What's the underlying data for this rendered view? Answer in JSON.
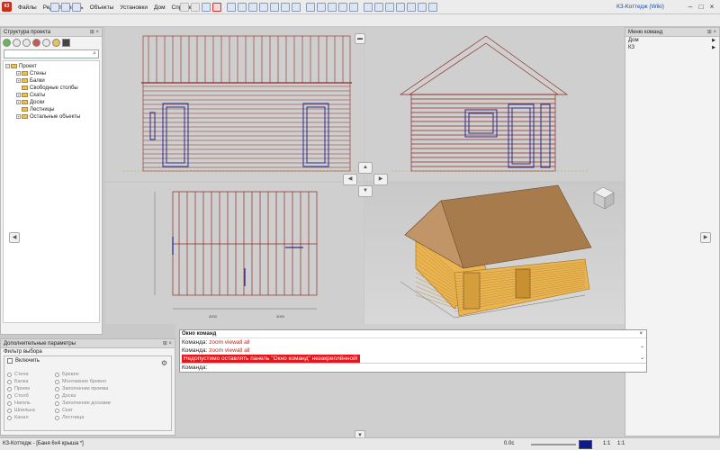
{
  "app": {
    "title": "КЗ-Коттедж (Wiki)",
    "icon_label": "К3"
  },
  "menu": [
    "Файлы",
    "Редактировать",
    "Объекты",
    "Установки",
    "Дом",
    "Справка"
  ],
  "project_panel": {
    "title": "Структура проекта",
    "tree_root": "Проект",
    "tree_items": [
      "Стены",
      "Балки",
      "Свободные столбы",
      "Скаты",
      "Доски",
      "Лестницы",
      "Остальные объекты"
    ]
  },
  "command_menu": {
    "title": "Меню команд",
    "items": [
      "Дом",
      "КЗ"
    ]
  },
  "params_panel": {
    "title": "Дополнительные параметры",
    "filter_title": "Фильтр выбора",
    "enable_label": "Включить",
    "col1": [
      "Стена",
      "Балка",
      "Проем",
      "Столб",
      "Нагель",
      "Шпилька",
      "Канал"
    ],
    "col2": [
      "Бревно",
      "Монтажное бревно",
      "Заполнение проема",
      "Доска",
      "Заполнение досками",
      "Скат",
      "Лестница"
    ]
  },
  "command_window": {
    "title": "Окно команд",
    "line1_prefix": "Команда:",
    "line1_value": "zoom viewall all",
    "line2_prefix": "Команда:",
    "line2_value": "zoom viewall all",
    "error": "Недопустимо оставлять панель \"Окно команд\" незакреплённой!",
    "input_label": "Команда:"
  },
  "plan_dims": [
    "3000",
    "3000"
  ],
  "status": {
    "document": "КЗ-Коттедж - [Баня 6х4 крыша *]",
    "coord": "0.0с",
    "scale1": "1:1",
    "scale2": "1:1"
  },
  "colors": {
    "wall_outline": "#8c2a22",
    "window_frame": "#2a2c8c",
    "roof_shingle": "#a87b4c",
    "log_wood": "#e8b24a",
    "error_bg": "#e5161c"
  }
}
